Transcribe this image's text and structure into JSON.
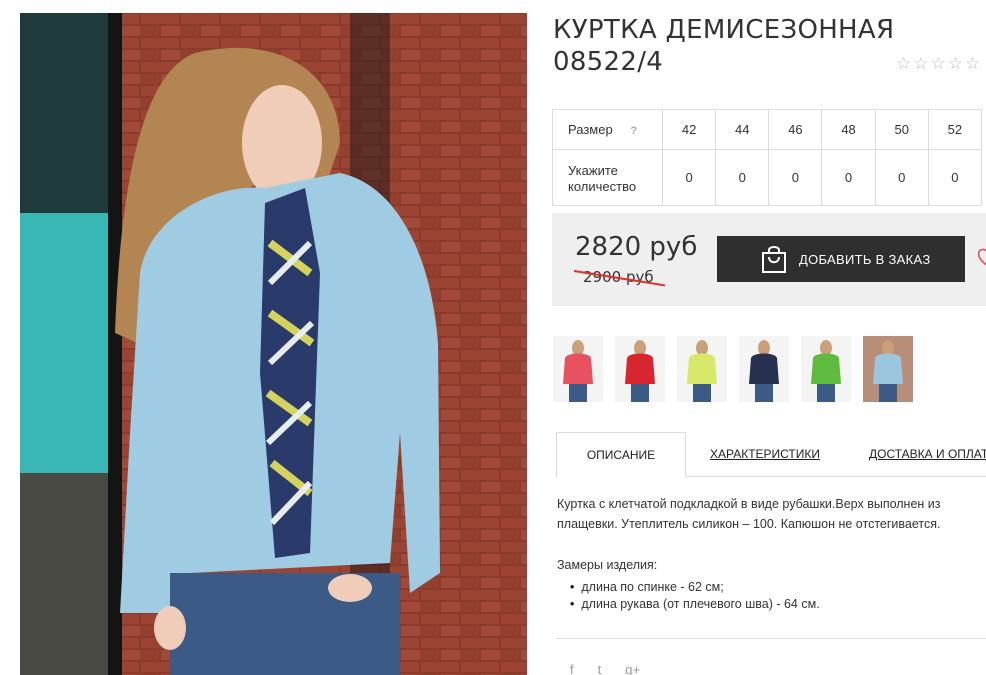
{
  "product": {
    "title": "КУРТКА ДЕМИСЕЗОННАЯ 08522/4",
    "rating_stars": [
      "☆",
      "☆",
      "☆",
      "☆",
      "☆"
    ]
  },
  "sizes": {
    "size_label": "Размер",
    "help": "?",
    "qty_label": "Укажите количество",
    "items": [
      {
        "size": "42",
        "qty": "0"
      },
      {
        "size": "44",
        "qty": "0"
      },
      {
        "size": "46",
        "qty": "0"
      },
      {
        "size": "48",
        "qty": "0"
      },
      {
        "size": "50",
        "qty": "0"
      },
      {
        "size": "52",
        "qty": "0"
      }
    ]
  },
  "pricing": {
    "price": "2820 руб",
    "old_price": "2900 руб",
    "add_to_order": "ДОБАВИТЬ В ЗАКАЗ"
  },
  "thumbnails": [
    {
      "color": "#e8515f",
      "name": "pink"
    },
    {
      "color": "#d8262f",
      "name": "red"
    },
    {
      "color": "#d9e86a",
      "name": "lime"
    },
    {
      "color": "#27304f",
      "name": "navy"
    },
    {
      "color": "#5fbb3d",
      "name": "green"
    },
    {
      "color": "#9cc6e0",
      "name": "light-blue"
    }
  ],
  "tabs": [
    {
      "label": "ОПИСАНИЕ"
    },
    {
      "label": "ХАРАКТЕРИСТИКИ"
    },
    {
      "label": "ДОСТАВКА И ОПЛАТА"
    }
  ],
  "description": {
    "text": "Куртка с клетчатой подкладкой в виде рубашки.Верх выполнен из плащевки. Утеплитель силикон – 100. Капюшон не отстегивается.",
    "measures_title": "Замеры изделия:",
    "measures": [
      "длина по спинке - 62 см;",
      "длина рукава (от плечевого шва) - 64 см."
    ]
  },
  "social": [
    "f",
    "t",
    "g+"
  ],
  "colors": {
    "accent_button": "#2f2f2f",
    "old_price_strike": "#e0322b",
    "price_box_bg": "#efefef"
  }
}
